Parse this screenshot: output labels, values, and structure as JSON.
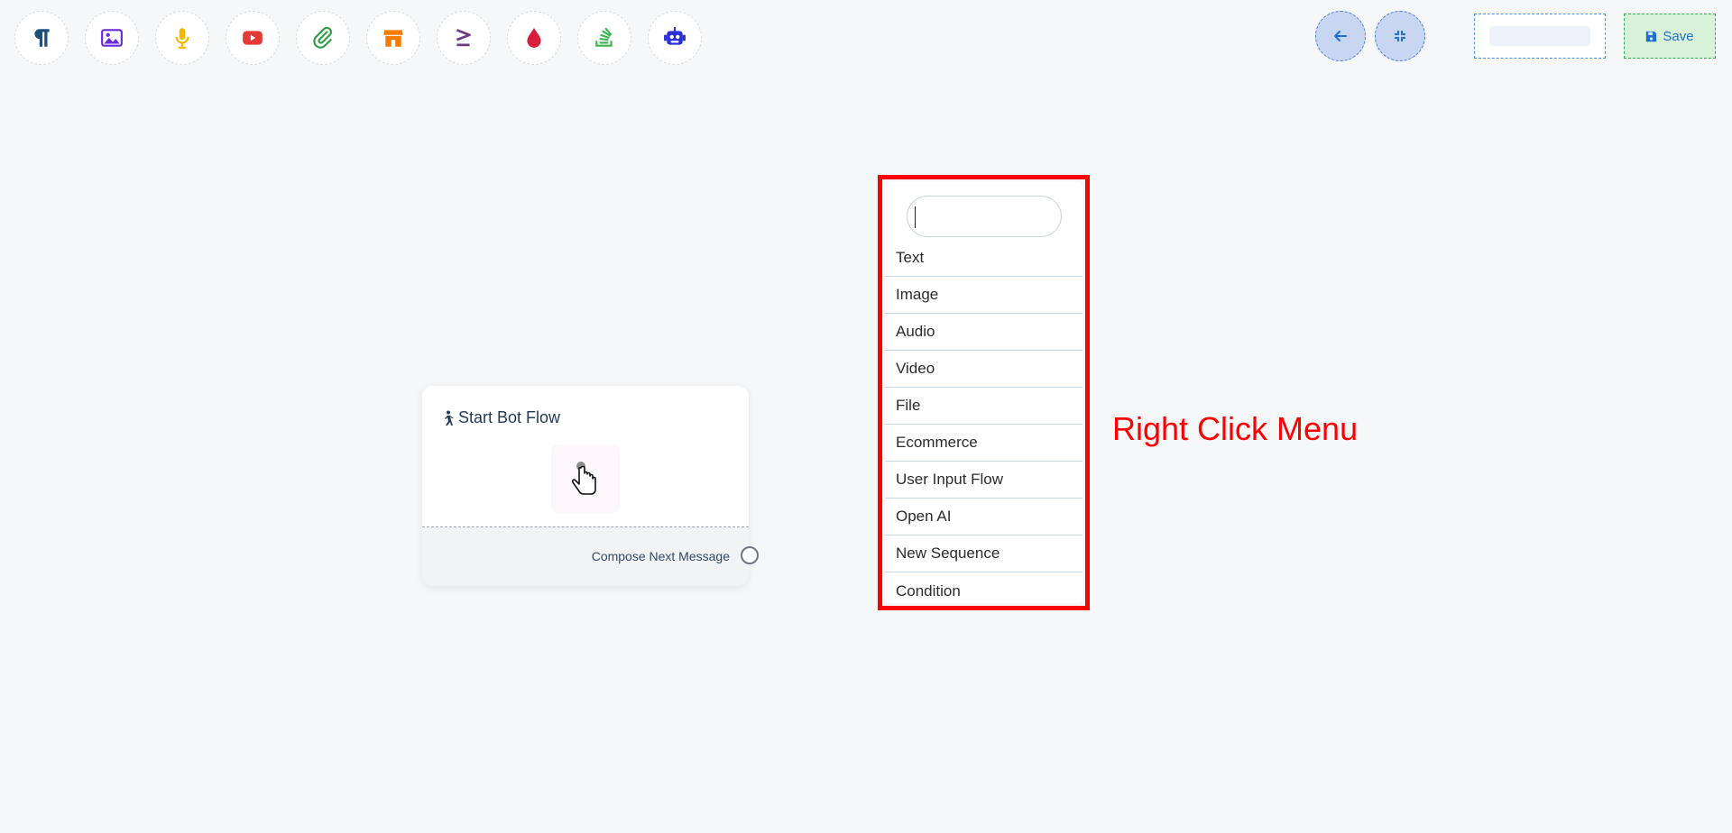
{
  "toolbar": {
    "tools": [
      {
        "icon": "paragraph-icon",
        "color": "#1e4f7a"
      },
      {
        "icon": "image-icon",
        "color": "#6a2bd8"
      },
      {
        "icon": "microphone-icon",
        "color": "#f5b800"
      },
      {
        "icon": "youtube-icon",
        "color": "#e53935"
      },
      {
        "icon": "paperclip-icon",
        "color": "#2e9e44"
      },
      {
        "icon": "store-icon",
        "color": "#f57c00"
      },
      {
        "icon": "greater-equal-icon",
        "color": "#6d3a80"
      },
      {
        "icon": "drop-icon",
        "color": "#d81e3a"
      },
      {
        "icon": "stack-icon",
        "color": "#3fb34f"
      },
      {
        "icon": "robot-icon",
        "color": "#2b2fd6"
      }
    ]
  },
  "header": {
    "back_icon": "arrow-left-icon",
    "collapse_icon": "compress-icon",
    "save_label": "Save",
    "save_icon": "floppy-disk-icon",
    "accent": "#1f6fd1"
  },
  "start_card": {
    "title": "Start Bot Flow",
    "title_icon": "walking-person-icon",
    "footer_label": "Compose Next Message"
  },
  "context_menu": {
    "search_value": "",
    "items": [
      "Text",
      "Image",
      "Audio",
      "Video",
      "File",
      "Ecommerce",
      "User Input Flow",
      "Open AI",
      "New Sequence",
      "Condition"
    ]
  },
  "annotation": {
    "label": "Right Click Menu",
    "color": "#ff0000"
  }
}
